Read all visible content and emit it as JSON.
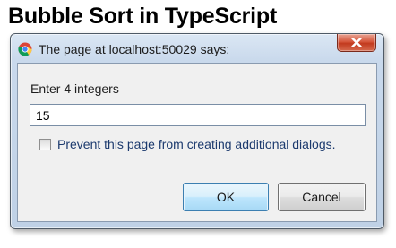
{
  "page": {
    "heading": "Bubble Sort in TypeScript"
  },
  "dialog": {
    "title": "The page at localhost:50029 says:",
    "prompt": "Enter 4 integers",
    "input_value": "15",
    "checkbox_label": "Prevent this page from creating additional dialogs.",
    "checkbox_checked": false,
    "ok_label": "OK",
    "cancel_label": "Cancel",
    "icon": "chrome-icon",
    "close_icon": "close-icon"
  },
  "colors": {
    "close_button": "#c23a1e",
    "ok_button_border": "#3c7fb1",
    "checkbox_label": "#1c3a6e"
  }
}
